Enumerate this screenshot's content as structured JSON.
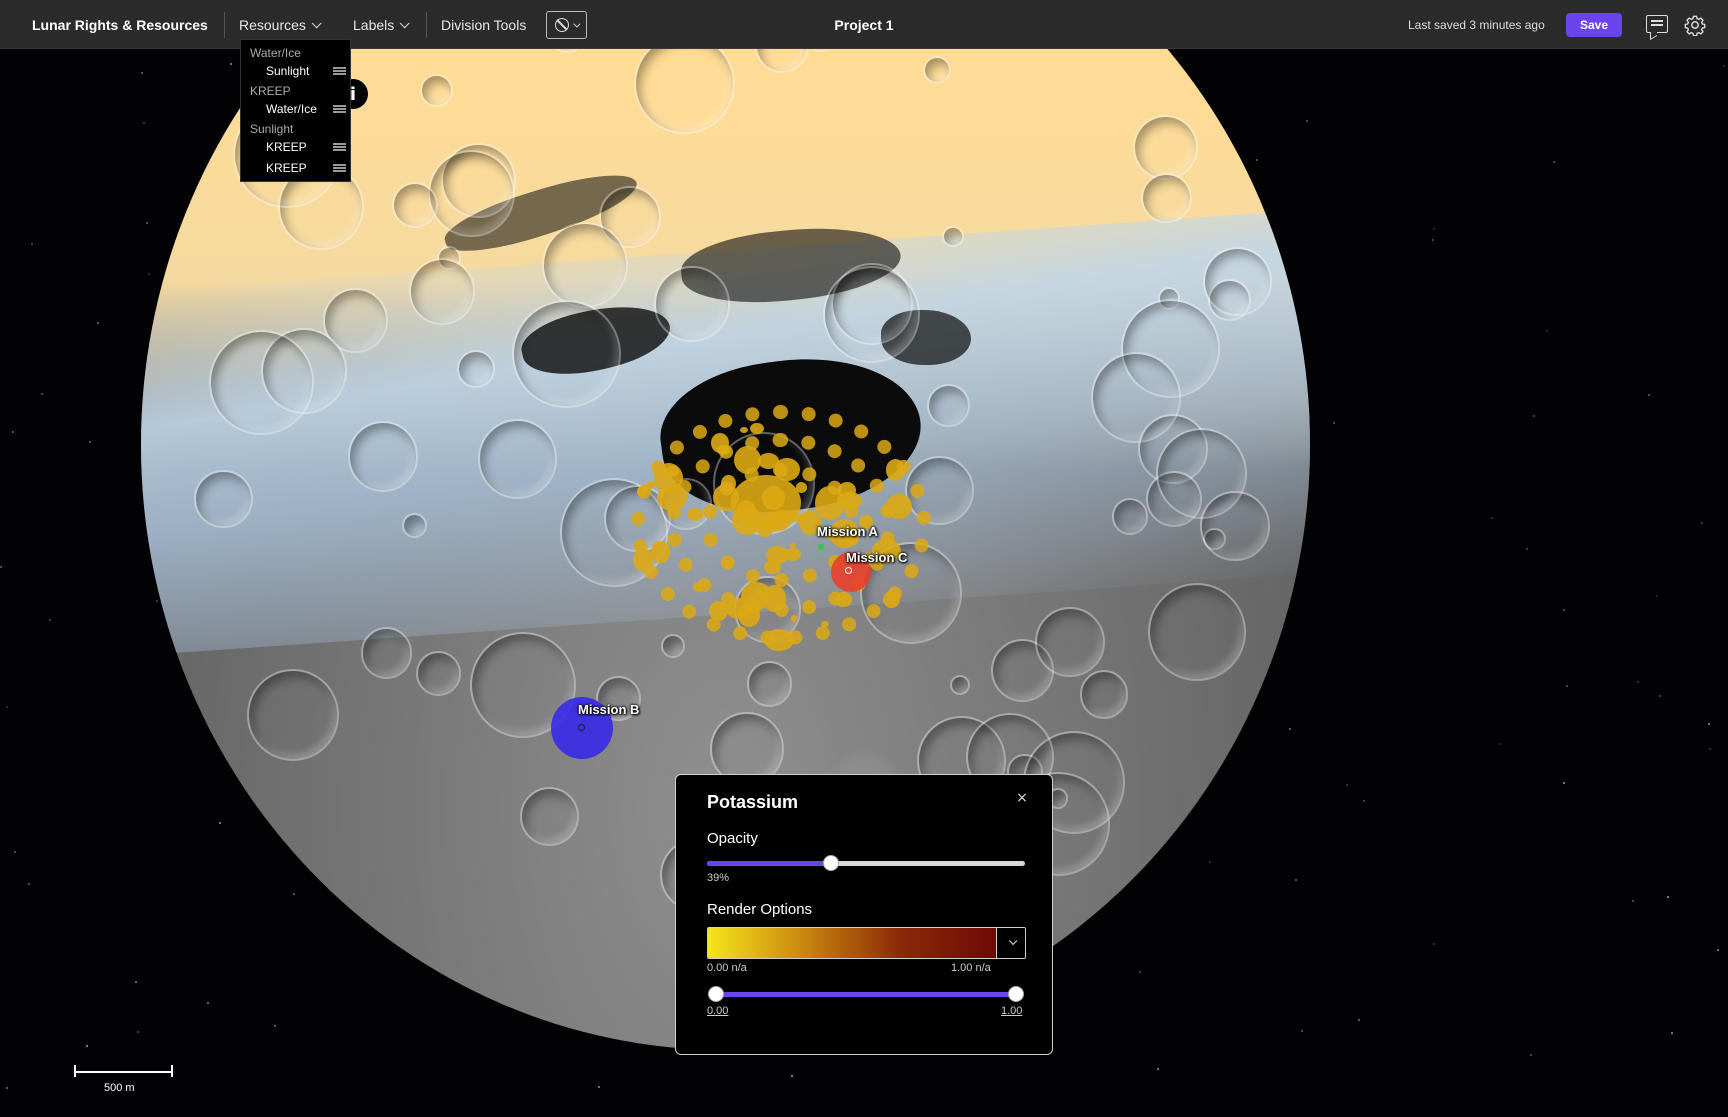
{
  "app": {
    "brand": "Lunar Rights & Resources",
    "menu": {
      "resources": "Resources",
      "labels": "Labels",
      "division_tools": "Division Tools"
    },
    "tool_selector_icon": "no-symbol-icon",
    "project_title": "Project 1",
    "last_saved": "Last saved 3 minutes ago",
    "save_label": "Save",
    "comment_icon": "comment-icon",
    "settings_icon": "gear-icon",
    "accent_color": "#6b44ec"
  },
  "resources_dropdown": {
    "groups": [
      {
        "label": "Water/Ice",
        "items": [
          "Sunlight"
        ]
      },
      {
        "label": "KREEP",
        "items": [
          "Water/Ice"
        ]
      },
      {
        "label": "Sunlight",
        "items": [
          "KREEP",
          "KREEP"
        ]
      }
    ]
  },
  "map": {
    "info_icon": "i",
    "missions": [
      {
        "label": "Mission A",
        "color": "#2ecc40"
      },
      {
        "label": "Mission C",
        "color": "#e8402a"
      },
      {
        "label": "Mission B",
        "color": "#3a2ee8"
      }
    ],
    "scale_label": "500 m"
  },
  "layer_panel": {
    "title": "Potassium",
    "close": "×",
    "opacity_label": "Opacity",
    "opacity_value": 0.39,
    "opacity_text": "39%",
    "render_label": "Render Options",
    "gradient_colors": [
      "#f6e41c",
      "#c9860f",
      "#8a2a08",
      "#6e0a06"
    ],
    "gradient_min_label": "0.00 n/a",
    "gradient_max_label": "1.00 n/a",
    "range_min": 0.0,
    "range_max": 1.0,
    "range_min_text": "0.00",
    "range_max_text": "1.00"
  }
}
